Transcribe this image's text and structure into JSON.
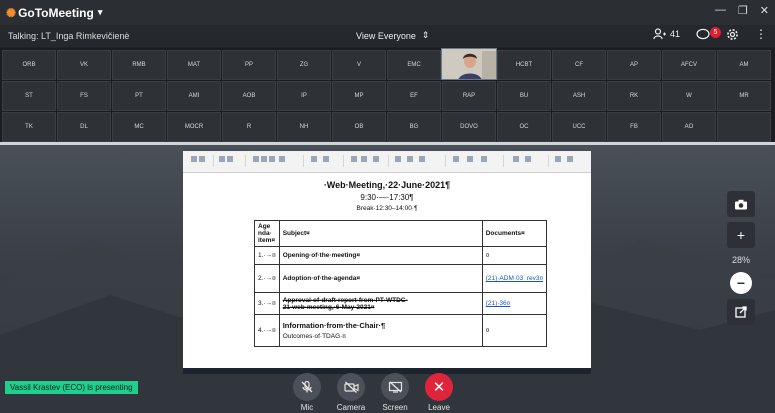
{
  "app": {
    "name": "GoToMeeting",
    "logo_glyph": "✺",
    "caret": "▾"
  },
  "window_controls": [
    "—",
    "❐",
    "✕"
  ],
  "toolbar": {
    "talking": "Talking: LT_Inga Rimkevičienė",
    "view_mode": "View Everyone",
    "view_mode_icon": "⇕",
    "attendees_icon": "people-icon",
    "attendee_count": "41",
    "chat_icon": "chat-icon",
    "chat_badge": "5",
    "settings_icon": "gear-icon",
    "more_icon": "⋮"
  },
  "participants": [
    [
      "ORB",
      "VK",
      "RMB",
      "MAT",
      "PP",
      "ZG",
      "V",
      "EMC",
      "",
      "HCBT",
      "CF",
      "AP",
      "AFCV",
      "AM"
    ],
    [
      "ST",
      "FS",
      "PT",
      "AMI",
      "AOB",
      "IP",
      "MP",
      "EF",
      "RAP",
      "BU",
      "ASH",
      "RK",
      "W",
      "MR"
    ],
    [
      "TK",
      "DL",
      "MC",
      "MOCR",
      "R",
      "NH",
      "OB",
      "BG",
      "DOVO",
      "OC",
      "UCC",
      "FB",
      "AO",
      ""
    ]
  ],
  "document": {
    "title": "·Web·Meeting,·22·June·2021¶",
    "time": "9:30·—·17:30¶",
    "break": "Break·12:30–14:00·¶",
    "headers": {
      "item": "Age nda· item¤",
      "subject": "Subject¤",
      "documents": "Documents¤"
    },
    "rows": [
      {
        "item": "1.·→¤",
        "subject": "Opening·of·the·meeting¤",
        "documents": "¤"
      },
      {
        "item": "2.·→¤",
        "subject": "Adoption·of·the·agenda¤",
        "documents": "(21)·ADM·03_rev3¤"
      },
      {
        "item": "3.·→¤",
        "subject": "Approval·of·draft·report·from·PT·WTDC-21·web·meeting,·6·May·2021¤",
        "documents": "(21)·36¤"
      },
      {
        "item": "4.·→¤",
        "subject": "Information·from·the·Chair·¶",
        "subject_sub": "Outcomes·of·TDAG·¤",
        "documents": "¤"
      }
    ]
  },
  "camera_controls": {
    "screenshot_icon": "camera-icon",
    "zoom_in": "+",
    "zoom_level": "28%",
    "zoom_out": "−",
    "popout_icon": "external-window-icon"
  },
  "presenter_banner": "Vassil Krastev (ECO) is presenting",
  "bottom_bar": [
    {
      "id": "mic",
      "label": "Mic",
      "glyph": "🎙"
    },
    {
      "id": "camera",
      "label": "Camera",
      "glyph": "📷"
    },
    {
      "id": "screen",
      "label": "Screen",
      "glyph": "▭"
    },
    {
      "id": "leave",
      "label": "Leave",
      "glyph": "✕"
    }
  ],
  "colors": {
    "accent": "#f68d2e",
    "leave": "#e0243b",
    "presenter": "#1fcf8e",
    "link": "#1a57c4"
  }
}
